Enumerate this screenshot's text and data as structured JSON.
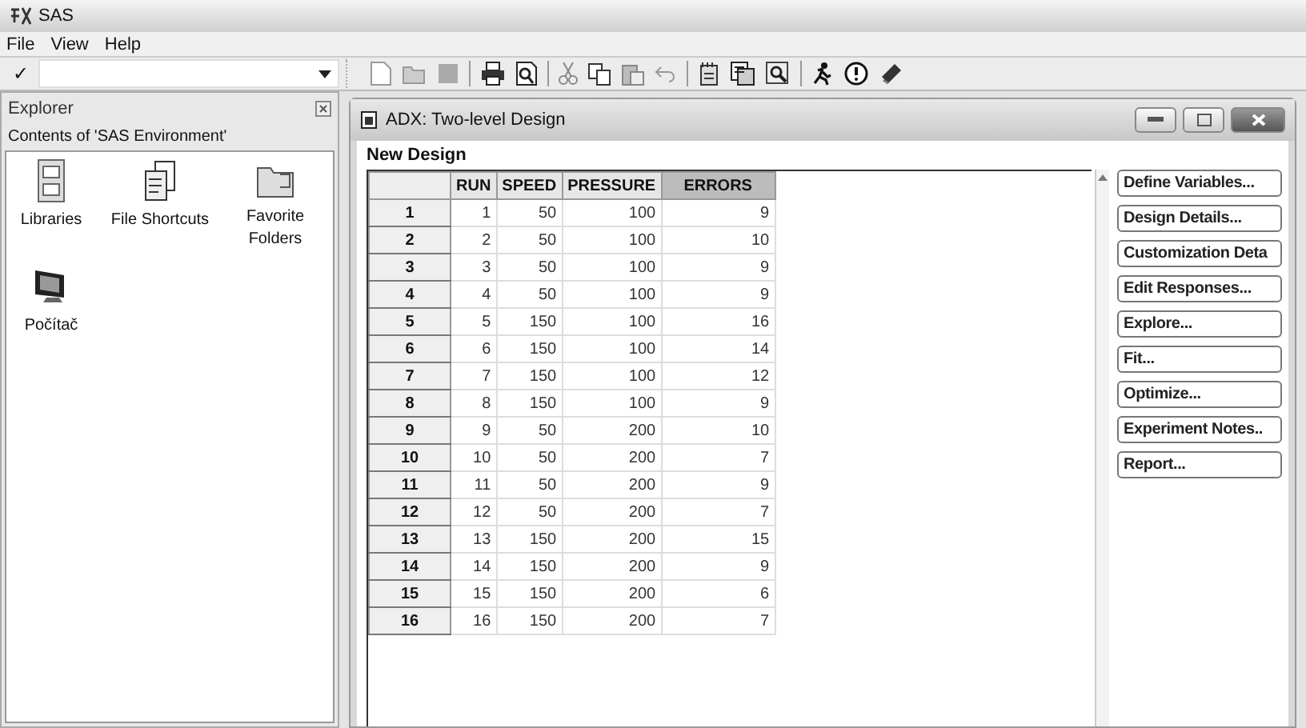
{
  "window": {
    "title": "SAS"
  },
  "menu": [
    "File",
    "View",
    "Help"
  ],
  "command_field": {
    "check": "✓"
  },
  "explorer": {
    "title": "Explorer",
    "subtitle": "Contents of 'SAS Environment'",
    "items": [
      {
        "kind": "libraries",
        "label": "Libraries"
      },
      {
        "kind": "shortcuts",
        "label": "File Shortcuts"
      },
      {
        "kind": "folders",
        "label": "Favorite Folders"
      },
      {
        "kind": "computer",
        "label": "Počítač"
      }
    ]
  },
  "design_window": {
    "title": "ADX: Two-level Design",
    "heading": "New Design",
    "table": {
      "columns": [
        {
          "label": "RUN",
          "selected": false
        },
        {
          "label": "SPEED",
          "selected": false
        },
        {
          "label": "PRESSURE",
          "selected": false
        },
        {
          "label": "ERRORS",
          "selected": true
        }
      ],
      "rows": [
        {
          "label": "1",
          "cells": [
            "1",
            "50",
            "100",
            "9"
          ]
        },
        {
          "label": "2",
          "cells": [
            "2",
            "50",
            "100",
            "10"
          ]
        },
        {
          "label": "3",
          "cells": [
            "3",
            "50",
            "100",
            "9"
          ]
        },
        {
          "label": "4",
          "cells": [
            "4",
            "50",
            "100",
            "9"
          ]
        },
        {
          "label": "5",
          "cells": [
            "5",
            "150",
            "100",
            "16"
          ]
        },
        {
          "label": "6",
          "cells": [
            "6",
            "150",
            "100",
            "14"
          ]
        },
        {
          "label": "7",
          "cells": [
            "7",
            "150",
            "100",
            "12"
          ]
        },
        {
          "label": "8",
          "cells": [
            "8",
            "150",
            "100",
            "9"
          ]
        },
        {
          "label": "9",
          "cells": [
            "9",
            "50",
            "200",
            "10"
          ]
        },
        {
          "label": "10",
          "cells": [
            "10",
            "50",
            "200",
            "7"
          ]
        },
        {
          "label": "11",
          "cells": [
            "11",
            "50",
            "200",
            "9"
          ]
        },
        {
          "label": "12",
          "cells": [
            "12",
            "50",
            "200",
            "7"
          ]
        },
        {
          "label": "13",
          "cells": [
            "13",
            "150",
            "200",
            "15"
          ]
        },
        {
          "label": "14",
          "cells": [
            "14",
            "150",
            "200",
            "9"
          ]
        },
        {
          "label": "15",
          "cells": [
            "15",
            "150",
            "200",
            "6"
          ]
        },
        {
          "label": "16",
          "cells": [
            "16",
            "150",
            "200",
            "7"
          ]
        }
      ]
    },
    "buttons": [
      "Define Variables...",
      "Design Details...",
      "Customization Deta",
      "Edit Responses...",
      "Explore...",
      "Fit...",
      "Optimize...",
      "Experiment Notes..",
      "Report..."
    ]
  }
}
